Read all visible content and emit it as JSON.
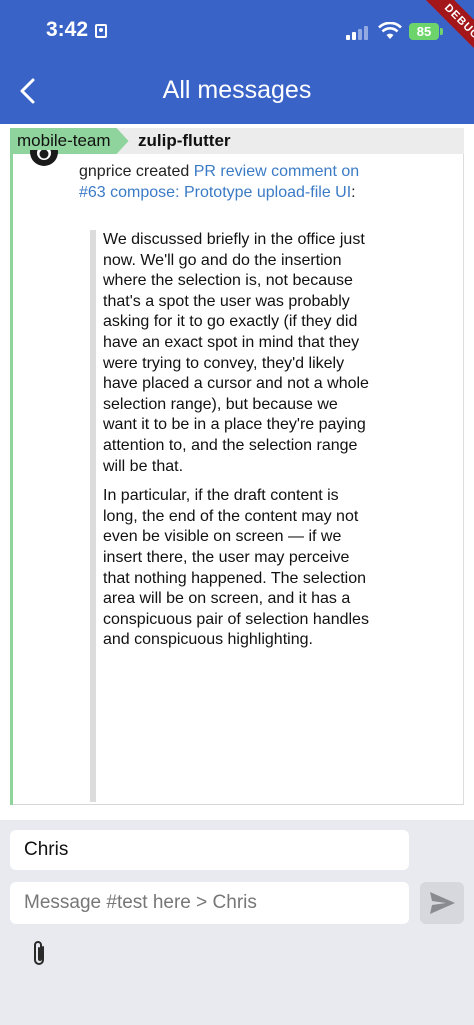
{
  "status_bar": {
    "time": "3:42",
    "battery": "85",
    "debug_banner": "DEBUG"
  },
  "app_bar": {
    "title": "All messages",
    "back_icon": "chevron-left-icon"
  },
  "recipient": {
    "stream": "mobile-team",
    "topic": "zulip-flutter",
    "stream_color": "#8fd49c"
  },
  "message": {
    "author_action": "gnprice created ",
    "link_text": "PR review comment on #63 compose: Prototype upload-file UI",
    "suffix": ":",
    "quote_paragraphs": [
      "We discussed briefly in the office just now. We'll go and do the insertion where the selection is, not because that's a spot the user was probably asking for it to go exactly (if they did have an exact spot in mind that they were trying to convey, they'd likely have placed a cursor and not a whole selection range), but because we want it to be in a place they're paying attention to, and the selection range will be that.",
      "In particular, if the draft content is long, the end of the content may not even be visible on screen — if we insert there, the user may perceive that nothing happened. The selection area will be on screen, and it has a conspicuous pair of selection handles and conspicuous highlighting."
    ]
  },
  "compose": {
    "topic_value": "Chris",
    "message_placeholder": "Message #test here > Chris",
    "send_icon": "send-icon",
    "attach_icon": "paperclip-icon"
  },
  "colors": {
    "app_bar": "#3a63c8",
    "link": "#3b7bc6",
    "compose_bg": "#e9eaf0"
  }
}
